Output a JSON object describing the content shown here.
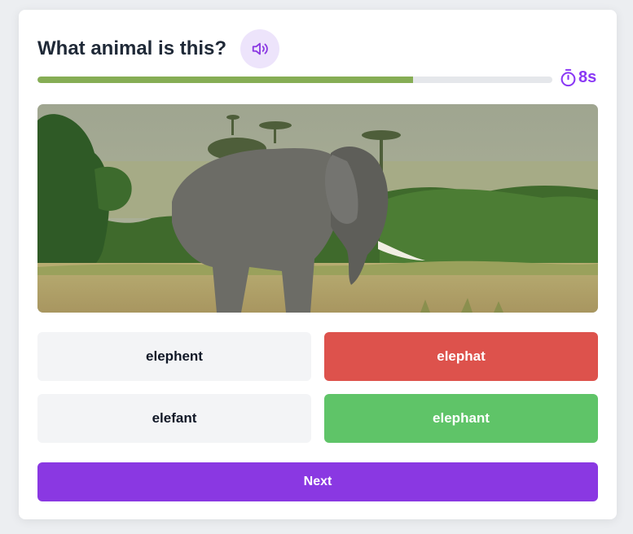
{
  "quiz": {
    "question": "What animal is this?",
    "speaker_icon": "speaker-icon",
    "progress_fraction": 0.73,
    "timer_text": "8s",
    "timer_icon": "stopwatch-icon",
    "image_subject": "elephant",
    "options": [
      {
        "label": "elephent",
        "state": "neutral"
      },
      {
        "label": "elephat",
        "state": "wrong"
      },
      {
        "label": "elefant",
        "state": "neutral"
      },
      {
        "label": "elephant",
        "state": "correct"
      }
    ],
    "next_label": "Next"
  },
  "colors": {
    "accent": "#8a38e2",
    "progress": "#86ad55",
    "wrong": "#dd524c",
    "correct": "#5fc468",
    "neutral": "#f3f4f6"
  }
}
